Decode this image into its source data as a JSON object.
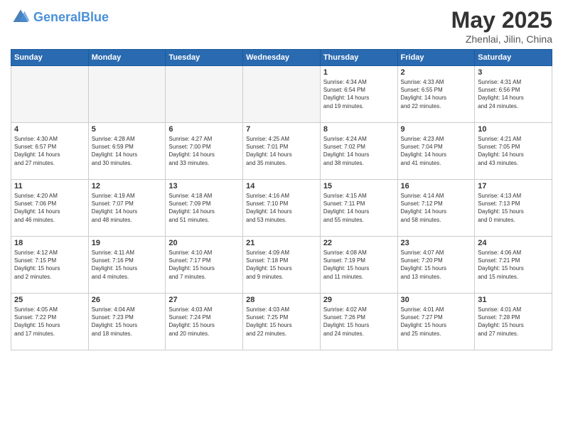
{
  "header": {
    "logo_general": "General",
    "logo_blue": "Blue",
    "title": "May 2025",
    "subtitle": "Zhenlai, Jilin, China"
  },
  "weekdays": [
    "Sunday",
    "Monday",
    "Tuesday",
    "Wednesday",
    "Thursday",
    "Friday",
    "Saturday"
  ],
  "weeks": [
    [
      {
        "day": "",
        "info": ""
      },
      {
        "day": "",
        "info": ""
      },
      {
        "day": "",
        "info": ""
      },
      {
        "day": "",
        "info": ""
      },
      {
        "day": "1",
        "info": "Sunrise: 4:34 AM\nSunset: 6:54 PM\nDaylight: 14 hours\nand 19 minutes."
      },
      {
        "day": "2",
        "info": "Sunrise: 4:33 AM\nSunset: 6:55 PM\nDaylight: 14 hours\nand 22 minutes."
      },
      {
        "day": "3",
        "info": "Sunrise: 4:31 AM\nSunset: 6:56 PM\nDaylight: 14 hours\nand 24 minutes."
      }
    ],
    [
      {
        "day": "4",
        "info": "Sunrise: 4:30 AM\nSunset: 6:57 PM\nDaylight: 14 hours\nand 27 minutes."
      },
      {
        "day": "5",
        "info": "Sunrise: 4:28 AM\nSunset: 6:59 PM\nDaylight: 14 hours\nand 30 minutes."
      },
      {
        "day": "6",
        "info": "Sunrise: 4:27 AM\nSunset: 7:00 PM\nDaylight: 14 hours\nand 33 minutes."
      },
      {
        "day": "7",
        "info": "Sunrise: 4:25 AM\nSunset: 7:01 PM\nDaylight: 14 hours\nand 35 minutes."
      },
      {
        "day": "8",
        "info": "Sunrise: 4:24 AM\nSunset: 7:02 PM\nDaylight: 14 hours\nand 38 minutes."
      },
      {
        "day": "9",
        "info": "Sunrise: 4:23 AM\nSunset: 7:04 PM\nDaylight: 14 hours\nand 41 minutes."
      },
      {
        "day": "10",
        "info": "Sunrise: 4:21 AM\nSunset: 7:05 PM\nDaylight: 14 hours\nand 43 minutes."
      }
    ],
    [
      {
        "day": "11",
        "info": "Sunrise: 4:20 AM\nSunset: 7:06 PM\nDaylight: 14 hours\nand 46 minutes."
      },
      {
        "day": "12",
        "info": "Sunrise: 4:19 AM\nSunset: 7:07 PM\nDaylight: 14 hours\nand 48 minutes."
      },
      {
        "day": "13",
        "info": "Sunrise: 4:18 AM\nSunset: 7:09 PM\nDaylight: 14 hours\nand 51 minutes."
      },
      {
        "day": "14",
        "info": "Sunrise: 4:16 AM\nSunset: 7:10 PM\nDaylight: 14 hours\nand 53 minutes."
      },
      {
        "day": "15",
        "info": "Sunrise: 4:15 AM\nSunset: 7:11 PM\nDaylight: 14 hours\nand 55 minutes."
      },
      {
        "day": "16",
        "info": "Sunrise: 4:14 AM\nSunset: 7:12 PM\nDaylight: 14 hours\nand 58 minutes."
      },
      {
        "day": "17",
        "info": "Sunrise: 4:13 AM\nSunset: 7:13 PM\nDaylight: 15 hours\nand 0 minutes."
      }
    ],
    [
      {
        "day": "18",
        "info": "Sunrise: 4:12 AM\nSunset: 7:15 PM\nDaylight: 15 hours\nand 2 minutes."
      },
      {
        "day": "19",
        "info": "Sunrise: 4:11 AM\nSunset: 7:16 PM\nDaylight: 15 hours\nand 4 minutes."
      },
      {
        "day": "20",
        "info": "Sunrise: 4:10 AM\nSunset: 7:17 PM\nDaylight: 15 hours\nand 7 minutes."
      },
      {
        "day": "21",
        "info": "Sunrise: 4:09 AM\nSunset: 7:18 PM\nDaylight: 15 hours\nand 9 minutes."
      },
      {
        "day": "22",
        "info": "Sunrise: 4:08 AM\nSunset: 7:19 PM\nDaylight: 15 hours\nand 11 minutes."
      },
      {
        "day": "23",
        "info": "Sunrise: 4:07 AM\nSunset: 7:20 PM\nDaylight: 15 hours\nand 13 minutes."
      },
      {
        "day": "24",
        "info": "Sunrise: 4:06 AM\nSunset: 7:21 PM\nDaylight: 15 hours\nand 15 minutes."
      }
    ],
    [
      {
        "day": "25",
        "info": "Sunrise: 4:05 AM\nSunset: 7:22 PM\nDaylight: 15 hours\nand 17 minutes."
      },
      {
        "day": "26",
        "info": "Sunrise: 4:04 AM\nSunset: 7:23 PM\nDaylight: 15 hours\nand 18 minutes."
      },
      {
        "day": "27",
        "info": "Sunrise: 4:03 AM\nSunset: 7:24 PM\nDaylight: 15 hours\nand 20 minutes."
      },
      {
        "day": "28",
        "info": "Sunrise: 4:03 AM\nSunset: 7:25 PM\nDaylight: 15 hours\nand 22 minutes."
      },
      {
        "day": "29",
        "info": "Sunrise: 4:02 AM\nSunset: 7:26 PM\nDaylight: 15 hours\nand 24 minutes."
      },
      {
        "day": "30",
        "info": "Sunrise: 4:01 AM\nSunset: 7:27 PM\nDaylight: 15 hours\nand 25 minutes."
      },
      {
        "day": "31",
        "info": "Sunrise: 4:01 AM\nSunset: 7:28 PM\nDaylight: 15 hours\nand 27 minutes."
      }
    ]
  ]
}
